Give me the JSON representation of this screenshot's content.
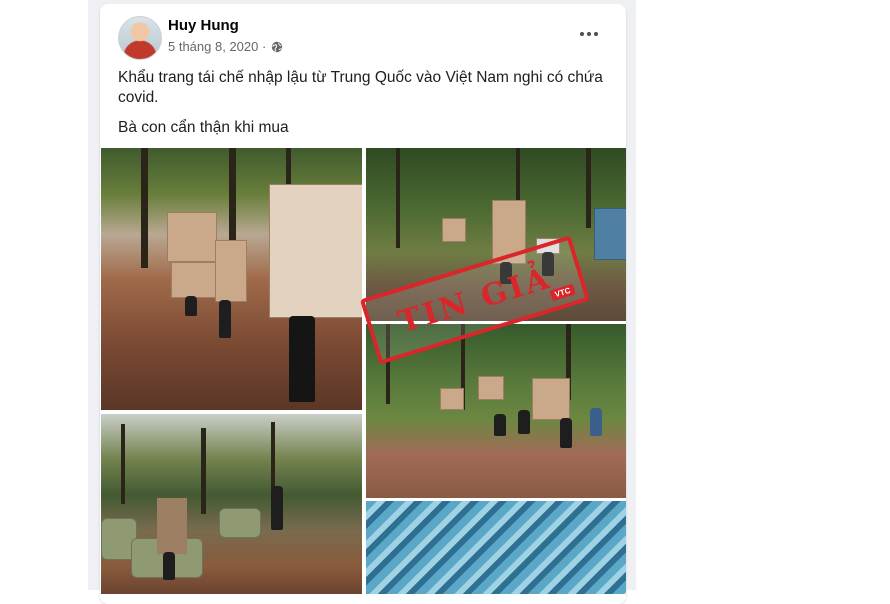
{
  "post": {
    "author": "Huy Hung",
    "date": "5 tháng 8, 2020 ·",
    "privacy_icon": "globe-icon",
    "more_icon": "more-options-icon",
    "text_line1": "Khẩu trang tái chế nhập lậu từ Trung Quốc vào Việt Nam nghi có chứa covid.",
    "text_line2": "Bà con cẩn thận khi mua"
  },
  "stamp": {
    "label": "TIN GIẢ",
    "tag": "VTC",
    "color": "#d9262b"
  }
}
